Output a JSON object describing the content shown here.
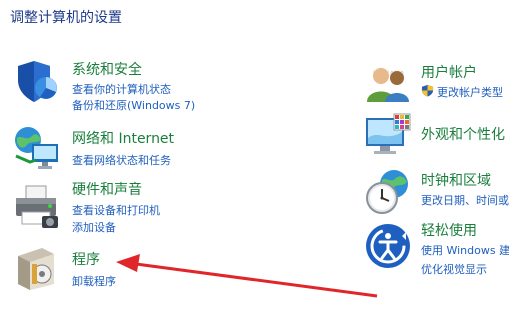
{
  "page": {
    "title": "调整计算机的设置"
  },
  "left_categories": [
    {
      "title": "系统和安全",
      "links": [
        "查看你的计算机状态",
        "备份和还原(Windows 7)"
      ]
    },
    {
      "title": "网络和 Internet",
      "links": [
        "查看网络状态和任务"
      ]
    },
    {
      "title": "硬件和声音",
      "links": [
        "查看设备和打印机",
        "添加设备"
      ]
    },
    {
      "title": "程序",
      "links": [
        "卸载程序"
      ]
    }
  ],
  "right_categories": [
    {
      "title": "用户帐户",
      "links": [
        "更改帐户类型"
      ]
    },
    {
      "title": "外观和个性化",
      "links": []
    },
    {
      "title": "时钟和区域",
      "links": [
        "更改日期、时间或数字格式"
      ]
    },
    {
      "title": "轻松使用",
      "links": [
        "使用 Windows 建议的设置",
        "优化视觉显示"
      ]
    }
  ],
  "colors": {
    "category_title": "#1a7f3c",
    "link": "#1f5fbf",
    "annotation_arrow": "#e0262a"
  }
}
